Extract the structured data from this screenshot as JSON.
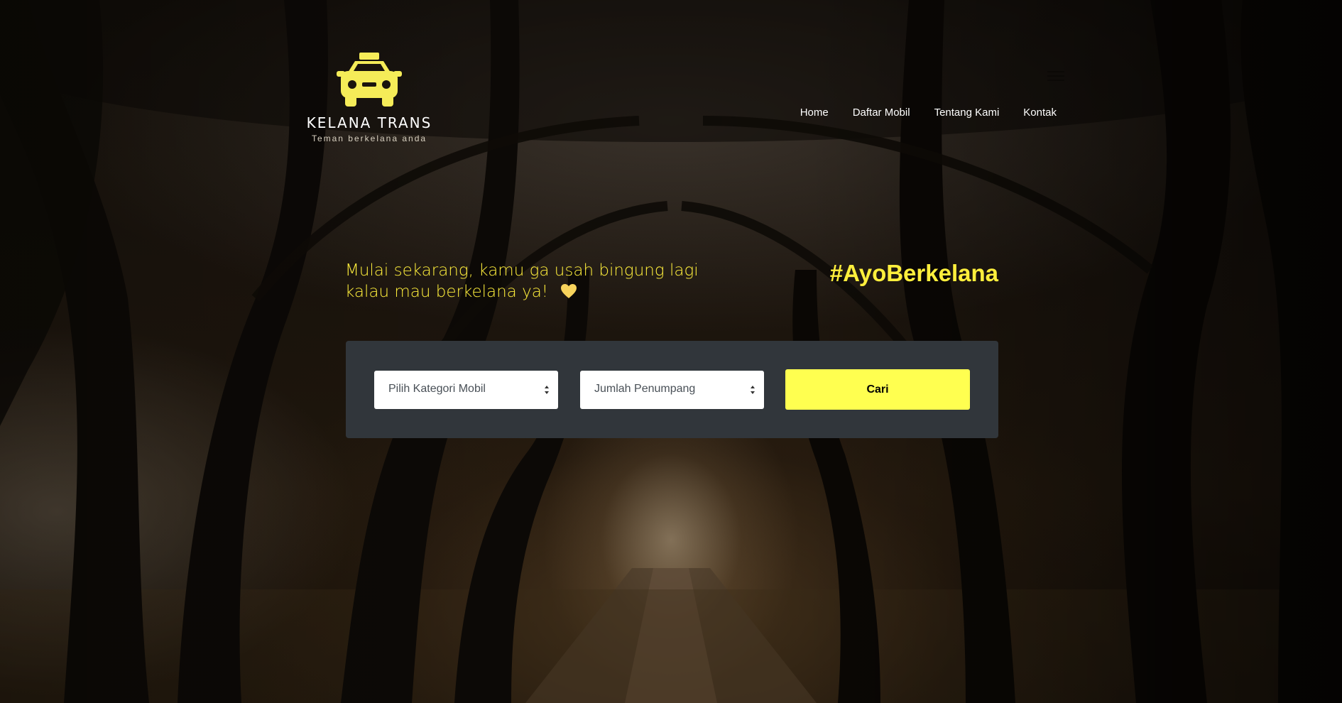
{
  "brand": {
    "name": "KELANA TRANS",
    "tagline": "Teman berkelana anda",
    "logo_icon": "taxi-icon",
    "color": "#f5ec58"
  },
  "nav": {
    "items": [
      {
        "label": "Home"
      },
      {
        "label": "Daftar Mobil"
      },
      {
        "label": "Tentang Kami"
      },
      {
        "label": "Kontak"
      }
    ]
  },
  "hero": {
    "line1": "Mulai sekarang, kamu ga usah bingung lagi",
    "line2": "kalau mau berkelana ya!",
    "heart_icon": "yellow-heart-icon",
    "hashtag": "#AyoBerkelana",
    "accent_color": "#ffef3c"
  },
  "search": {
    "category_select": {
      "value": "Pilih Kategori Mobil"
    },
    "passenger_select": {
      "value": "Jumlah Penumpang"
    },
    "submit_label": "Cari",
    "panel_color": "#31363b",
    "button_color": "#ffff50"
  }
}
